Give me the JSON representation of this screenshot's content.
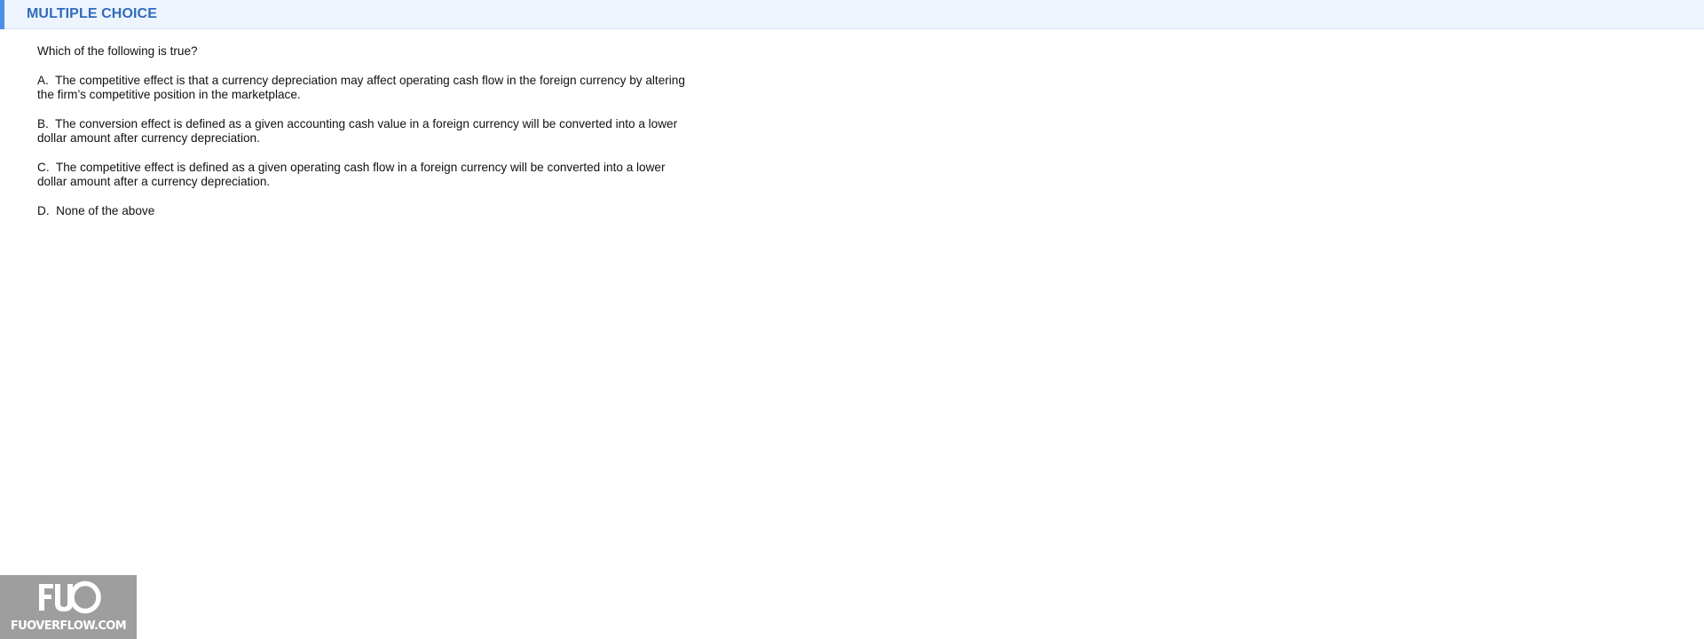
{
  "header": {
    "title": "MULTIPLE CHOICE"
  },
  "question": {
    "prompt": "Which of the following is true?",
    "options": [
      {
        "letter": "A.",
        "text": "The competitive effect is that a currency depreciation may affect operating cash flow in the foreign currency by altering the firm’s competitive position in the marketplace."
      },
      {
        "letter": "B.",
        "text": "The conversion effect is defined as a given accounting cash value in a foreign currency will be converted into a lower dollar amount after currency depreciation."
      },
      {
        "letter": "C.",
        "text": "The competitive effect is defined as a given operating cash flow in a foreign currency will be converted into a lower dollar amount after a currency depreciation."
      },
      {
        "letter": "D.",
        "text": "None of the above"
      }
    ]
  },
  "watermark": {
    "logo_text": "FUO",
    "site_text": "FUOVERFLOW.COM"
  },
  "colors": {
    "header_bg": "#eef4fd",
    "header_accent": "#4a8fe8",
    "header_title": "#2f6bc2",
    "watermark_bg": "#9e9e9e"
  }
}
